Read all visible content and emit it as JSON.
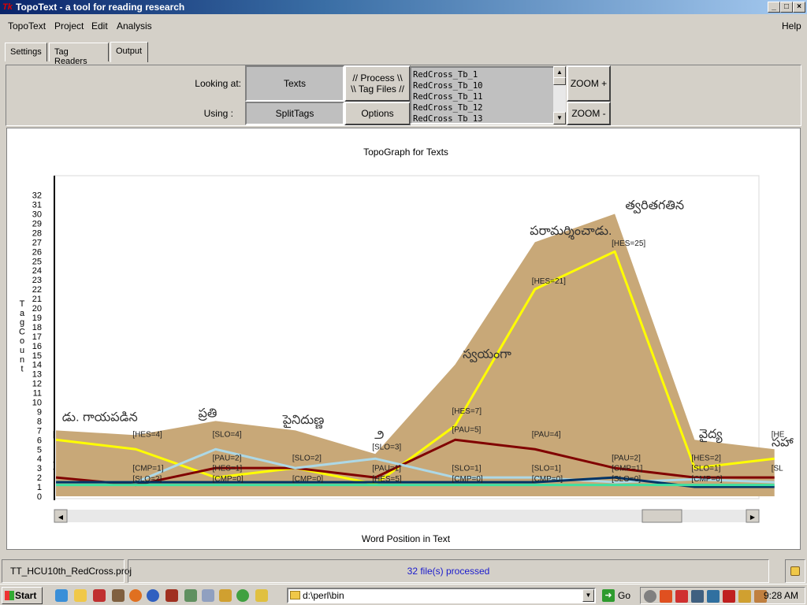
{
  "window": {
    "title": "TopoText - a tool for reading research",
    "app_icon_text": "Tk"
  },
  "window_buttons": {
    "minimize": "_",
    "maximize": "□",
    "close": "×"
  },
  "menubar": {
    "items": [
      "TopoText",
      "Project",
      "Edit",
      "Analysis"
    ],
    "help": "Help"
  },
  "tabs": [
    {
      "label": "Settings",
      "selected": false
    },
    {
      "label": "Tag Readers",
      "selected": false
    },
    {
      "label": "Output",
      "selected": true
    }
  ],
  "controls": {
    "looking_at_label": "Looking at:",
    "using_label": "Using :",
    "texts_button": "Texts",
    "splittags_button": "SplitTags",
    "process_line1": "// Process \\\\",
    "process_line2": "\\\\ Tag Files //",
    "options_button": "Options",
    "zoom_in": "ZOOM +",
    "zoom_out": "ZOOM -",
    "files": [
      "RedCross_Tb_1",
      "RedCross_Tb_10",
      "RedCross_Tb_11",
      "RedCross_Tb_12",
      "RedCross_Tb_13"
    ]
  },
  "chart_data": {
    "type": "area",
    "title": "TopoGraph for Texts",
    "xlabel": "Word Position in Text",
    "ylabel": "TagCount",
    "ylim": [
      0,
      32
    ],
    "yticks": [
      0,
      1,
      2,
      3,
      4,
      5,
      6,
      7,
      8,
      9,
      10,
      11,
      12,
      13,
      14,
      15,
      16,
      17,
      18,
      19,
      20,
      21,
      22,
      23,
      24,
      25,
      26,
      27,
      28,
      29,
      30,
      31,
      32
    ],
    "x": [
      0,
      1,
      2,
      3,
      4,
      5,
      6,
      7,
      8,
      9
    ],
    "area": {
      "color": "#c8a878",
      "values": [
        7,
        6.5,
        8,
        7,
        4.5,
        14,
        27,
        30,
        6,
        5
      ]
    },
    "series": [
      {
        "color": "#ffff00",
        "values": [
          6,
          5,
          2,
          3,
          1.3,
          7.5,
          22,
          26,
          3,
          4
        ]
      },
      {
        "color": "#800000",
        "values": [
          2,
          1.2,
          3,
          3,
          2,
          6,
          5,
          3,
          2,
          2
        ]
      },
      {
        "color": "#add8e6",
        "values": [
          1.5,
          1.5,
          5,
          3,
          4,
          2,
          2,
          1.5,
          1.8,
          1.5
        ]
      },
      {
        "color": "#003366",
        "values": [
          1.5,
          1.5,
          1.5,
          1.5,
          1.5,
          1.5,
          1.5,
          2,
          1,
          1
        ]
      },
      {
        "color": "#40e0a0",
        "values": [
          1.2,
          1.2,
          1.2,
          1.2,
          1.2,
          1.2,
          1.2,
          1.2,
          1.2,
          1.2
        ]
      }
    ],
    "annotations": [
      {
        "x": 0,
        "y": 6.3,
        "text": "["
      },
      {
        "x": 0,
        "y": 3,
        "text": "]"
      },
      {
        "x": 1,
        "y": 6.3,
        "text": "[HES=4]"
      },
      {
        "x": 1,
        "y": 2.7,
        "text": "[CMP=1]"
      },
      {
        "x": 1,
        "y": 1.6,
        "text": "[SLO=2]"
      },
      {
        "x": 2,
        "y": 6.3,
        "text": "[SLO=4]"
      },
      {
        "x": 2,
        "y": 3.8,
        "text": "[PAU=2]"
      },
      {
        "x": 2,
        "y": 2.7,
        "text": "[HES=1]"
      },
      {
        "x": 2,
        "y": 1.6,
        "text": "[CMP=0]"
      },
      {
        "x": 3,
        "y": 3.8,
        "text": "[SLO=2]"
      },
      {
        "x": 3,
        "y": 1.6,
        "text": "[CMP=0]"
      },
      {
        "x": 4,
        "y": 5,
        "text": "[SLO=3]"
      },
      {
        "x": 4,
        "y": 2.7,
        "text": "[PAU=1]"
      },
      {
        "x": 4,
        "y": 1.6,
        "text": "[HES=5]"
      },
      {
        "x": 5,
        "y": 8.8,
        "text": "[HES=7]"
      },
      {
        "x": 5,
        "y": 6.8,
        "text": "[PAU=5]"
      },
      {
        "x": 5,
        "y": 2.7,
        "text": "[SLO=1]"
      },
      {
        "x": 5,
        "y": 1.6,
        "text": "[CMP=0]"
      },
      {
        "x": 6,
        "y": 22.6,
        "text": "[HES=21]"
      },
      {
        "x": 6,
        "y": 6.3,
        "text": "[PAU=4]"
      },
      {
        "x": 6,
        "y": 2.7,
        "text": "[SLO=1]"
      },
      {
        "x": 6,
        "y": 1.6,
        "text": "[CMP=0]"
      },
      {
        "x": 7,
        "y": 26.6,
        "text": "[HES=25]"
      },
      {
        "x": 7,
        "y": 3.8,
        "text": "[PAU=2]"
      },
      {
        "x": 7,
        "y": 2.7,
        "text": "[CMP=1]"
      },
      {
        "x": 7,
        "y": 1.6,
        "text": "[SLO=0]"
      },
      {
        "x": 8,
        "y": 3.8,
        "text": "[HES=2]"
      },
      {
        "x": 8,
        "y": 2.7,
        "text": "[SLO=1]"
      },
      {
        "x": 8,
        "y": 1.6,
        "text": "[CMP=0]"
      },
      {
        "x": 9,
        "y": 6.3,
        "text": "[HE"
      },
      {
        "x": 9,
        "y": 2.7,
        "text": "[SL"
      }
    ],
    "words": [
      {
        "x": 0.55,
        "y": 8,
        "text": "డు. గాయపడిన"
      },
      {
        "x": 1.9,
        "y": 8.4,
        "text": "ప్రతి"
      },
      {
        "x": 3.1,
        "y": 7.7,
        "text": "పైనిదుణ్ణ"
      },
      {
        "x": 4.05,
        "y": 6.1,
        "text": "౨"
      },
      {
        "x": 5.4,
        "y": 14.7,
        "text": "స్వయంగా"
      },
      {
        "x": 6.45,
        "y": 27.8,
        "text": "పరామర్శించాడు."
      },
      {
        "x": 7.5,
        "y": 30.5,
        "text": "త్వరితగతిన"
      },
      {
        "x": 8.2,
        "y": 6.2,
        "text": "వైద్య"
      },
      {
        "x": 9.1,
        "y": 5.3,
        "text": "సహా"
      }
    ]
  },
  "status": {
    "project": "TT_HCU10th_RedCross.proj",
    "message": "32 file(s) processed"
  },
  "taskbar": {
    "start": "Start",
    "address": "d:\\perl\\bin",
    "go": "Go",
    "clock": "9:28 AM"
  }
}
